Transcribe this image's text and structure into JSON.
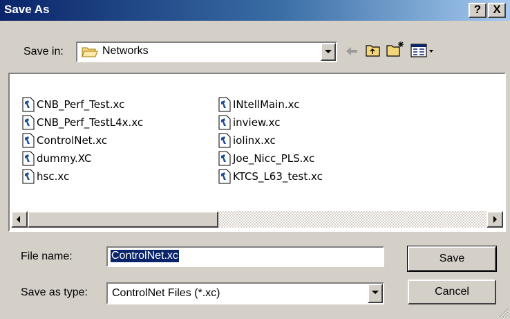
{
  "window": {
    "title": "Save As",
    "help_label": "?",
    "close_label": "X"
  },
  "toolbar": {
    "save_in_label": "Save in:",
    "current_folder": "Networks",
    "icons": [
      "back-arrow-icon",
      "up-folder-icon",
      "new-folder-icon",
      "view-menu-icon"
    ]
  },
  "files": [
    {
      "name": "CNB_Perf_Test.xc"
    },
    {
      "name": "CNB_Perf_TestL4x.xc"
    },
    {
      "name": "ControlNet.xc"
    },
    {
      "name": "dummy.XC"
    },
    {
      "name": "hsc.xc"
    },
    {
      "name": "INtellMain.xc"
    },
    {
      "name": "inview.xc"
    },
    {
      "name": "iolinx.xc"
    },
    {
      "name": "Joe_Nicc_PLS.xc"
    },
    {
      "name": "KTCS_L63_test.xc"
    }
  ],
  "form": {
    "file_name_label": "File name:",
    "file_name_value": "ControlNet.xc",
    "save_as_type_label": "Save as type:",
    "save_as_type_value": "ControlNet Files (*.xc)"
  },
  "buttons": {
    "save": "Save",
    "cancel": "Cancel"
  },
  "colors": {
    "title_bar": "#0a246a",
    "face": "#d4d0c8",
    "selection": "#0a246a"
  }
}
